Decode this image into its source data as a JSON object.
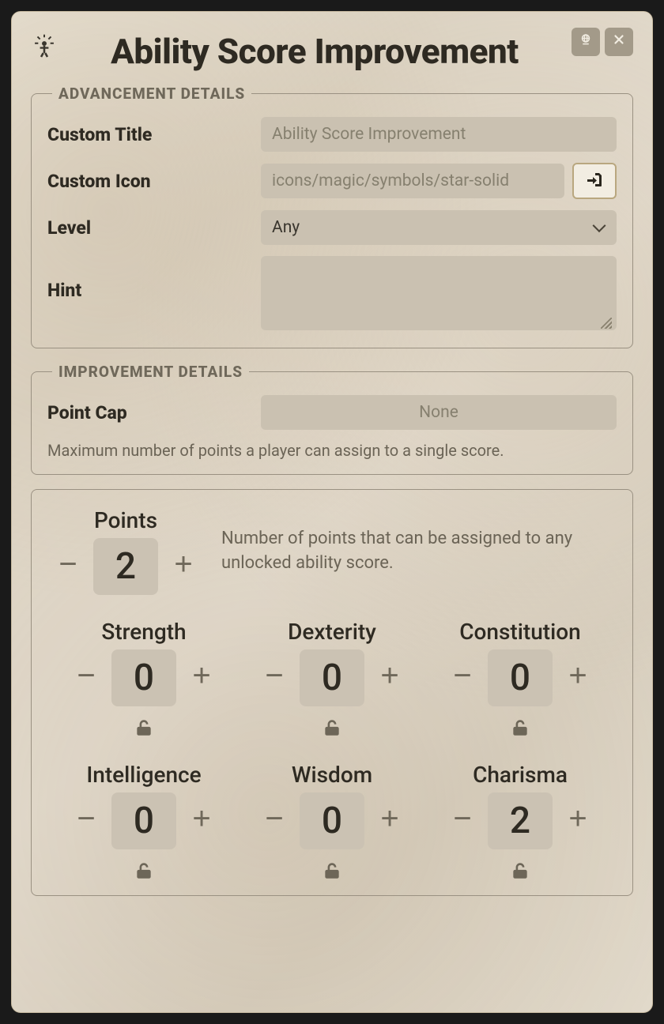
{
  "header": {
    "title": "Ability Score Improvement"
  },
  "advancement": {
    "legend": "ADVANCEMENT DETAILS",
    "custom_title_label": "Custom Title",
    "custom_title_placeholder": "Ability Score Improvement",
    "custom_title_value": "",
    "custom_icon_label": "Custom Icon",
    "custom_icon_placeholder": "icons/magic/symbols/star-solid",
    "custom_icon_value": "",
    "level_label": "Level",
    "level_value": "Any",
    "hint_label": "Hint",
    "hint_value": ""
  },
  "improvement": {
    "legend": "IMPROVEMENT DETAILS",
    "point_cap_label": "Point Cap",
    "point_cap_placeholder": "None",
    "point_cap_value": "",
    "point_cap_help": "Maximum number of points a player can assign to a single score."
  },
  "points": {
    "label": "Points",
    "value": "2",
    "description": "Number of points that can be assigned to any unlocked ability score."
  },
  "abilities": [
    {
      "key": "str",
      "label": "Strength",
      "value": "0",
      "locked": false
    },
    {
      "key": "dex",
      "label": "Dexterity",
      "value": "0",
      "locked": false
    },
    {
      "key": "con",
      "label": "Constitution",
      "value": "0",
      "locked": false
    },
    {
      "key": "int",
      "label": "Intelligence",
      "value": "0",
      "locked": false
    },
    {
      "key": "wis",
      "label": "Wisdom",
      "value": "0",
      "locked": false
    },
    {
      "key": "cha",
      "label": "Charisma",
      "value": "2",
      "locked": false
    }
  ]
}
